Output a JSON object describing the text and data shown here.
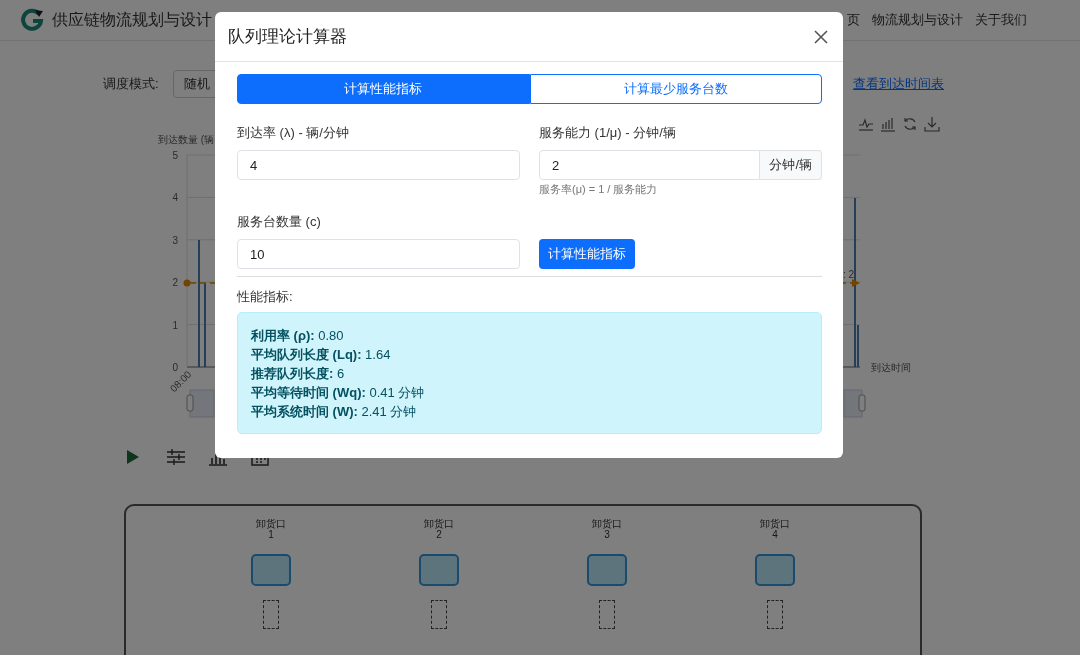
{
  "header": {
    "title": "供应链物流规划与设计",
    "nav": [
      {
        "label": "页"
      },
      {
        "label": "物流规划与设计"
      },
      {
        "label": "关于我们"
      }
    ]
  },
  "controls": {
    "label": "调度模式:",
    "select_value": "随机",
    "link": "查看到达时间表"
  },
  "chart": {
    "ylabel": "到达数量 (辆",
    "yticks": [
      "5",
      "4",
      "3",
      "2",
      "1",
      "0"
    ],
    "xtick": "08:00",
    "xlabel": "到达时间",
    "markline_label": ": 2"
  },
  "dock": {
    "bays": [
      {
        "label": "卸货口",
        "number": "1"
      },
      {
        "label": "卸货口",
        "number": "2"
      },
      {
        "label": "卸货口",
        "number": "3"
      },
      {
        "label": "卸货口",
        "number": "4"
      }
    ]
  },
  "dialog": {
    "title": "队列理论计算器",
    "tabs": [
      {
        "label": "计算性能指标",
        "selected": true
      },
      {
        "label": "计算最少服务台数",
        "selected": false
      }
    ],
    "fields": [
      {
        "label": "到达率 (λ) - 辆/分钟",
        "value": "4"
      },
      {
        "label": "服务能力 (1/μ) - 分钟/辆",
        "value": "2",
        "addon": "分钟/辆",
        "help": "服务率(μ) = 1 / 服务能力"
      },
      {
        "label": "服务台数量 (c)",
        "value": "10"
      }
    ],
    "submit": "计算性能指标",
    "results": {
      "heading": "性能指标:",
      "lines": [
        "**利用率 (ρ):** 0.80",
        "**平均队列长度 (Lq):** 1.64",
        "**推荐队列长度:** 6",
        "**平均等待时间 (Wq):** 0.41 分钟",
        "**平均系统时间 (W):** 2.41 分钟"
      ]
    }
  }
}
